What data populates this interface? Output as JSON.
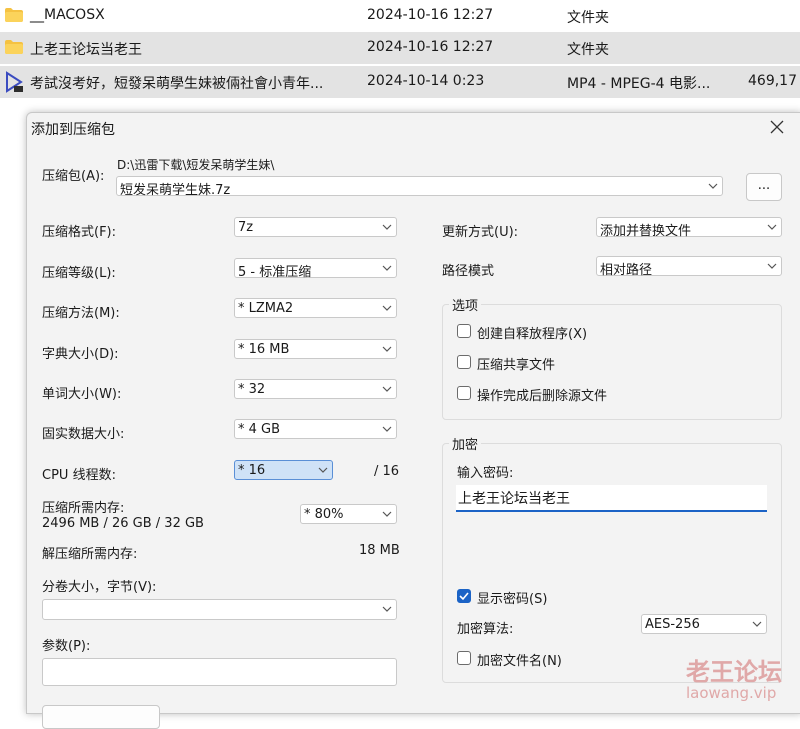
{
  "files": [
    {
      "icon": "folder-icon",
      "name": "__MACOSX",
      "date": "2024-10-16 12:27",
      "type": "文件夹",
      "size": ""
    },
    {
      "icon": "folder-icon",
      "name": "上老王论坛当老王",
      "date": "2024-10-16 12:27",
      "type": "文件夹",
      "size": ""
    },
    {
      "icon": "video-file-icon",
      "name": "考試沒考好，短發呆萌學生妹被倆社會小青年...",
      "date": "2024-10-14 0:23",
      "type": "MP4 - MPEG-4 电影...",
      "size": "469,17"
    }
  ],
  "dialog": {
    "title": "添加到压缩包",
    "archive_label": "压缩包(A):",
    "archive_path": "D:\\迅雷下载\\短发呆萌学生妹\\",
    "archive_name": "短发呆萌学生妹.7z",
    "browse_label": "...",
    "format_label": "压缩格式(F):",
    "format_value": "7z",
    "level_label": "压缩等级(L):",
    "level_value": "5 - 标准压缩",
    "method_label": "压缩方法(M):",
    "method_value": "*  LZMA2",
    "dict_label": "字典大小(D):",
    "dict_value": "*  16 MB",
    "word_label": "单词大小(W):",
    "word_value": "*  32",
    "solid_label": "固实数据大小:",
    "solid_value": "*  4 GB",
    "cpu_label": "CPU 线程数:",
    "cpu_value": "*  16",
    "cpu_total": "/ 16",
    "mem_label": "压缩所需内存:",
    "mem_value": "2496 MB / 26 GB / 32 GB",
    "mem_pct": "*  80%",
    "decomp_label": "解压缩所需内存:",
    "decomp_value": "18 MB",
    "split_label": "分卷大小，字节(V):",
    "split_value": "",
    "params_label": "参数(P):",
    "params_value": "",
    "update_label": "更新方式(U):",
    "update_value": "添加并替换文件",
    "pathmode_label": "路径模式",
    "pathmode_value": "相对路径",
    "options_title": "选项",
    "opt_sfx": "创建自释放程序(X)",
    "opt_shared": "压缩共享文件",
    "opt_delete": "操作完成后删除源文件",
    "encrypt_title": "加密",
    "password_label": "输入密码:",
    "password_value": "上老王论坛当老王",
    "show_password": "显示密码(S)",
    "algo_label": "加密算法:",
    "algo_value": "AES-256",
    "encrypt_names": "加密文件名(N)"
  },
  "watermark": {
    "cn": "老王论坛",
    "url": "laowang.vip"
  },
  "colors": {
    "accent": "#1b63c6",
    "folder": "#f5c242",
    "selected_row": "#e3e3e3",
    "dialog_bg": "#f3f3f3"
  }
}
